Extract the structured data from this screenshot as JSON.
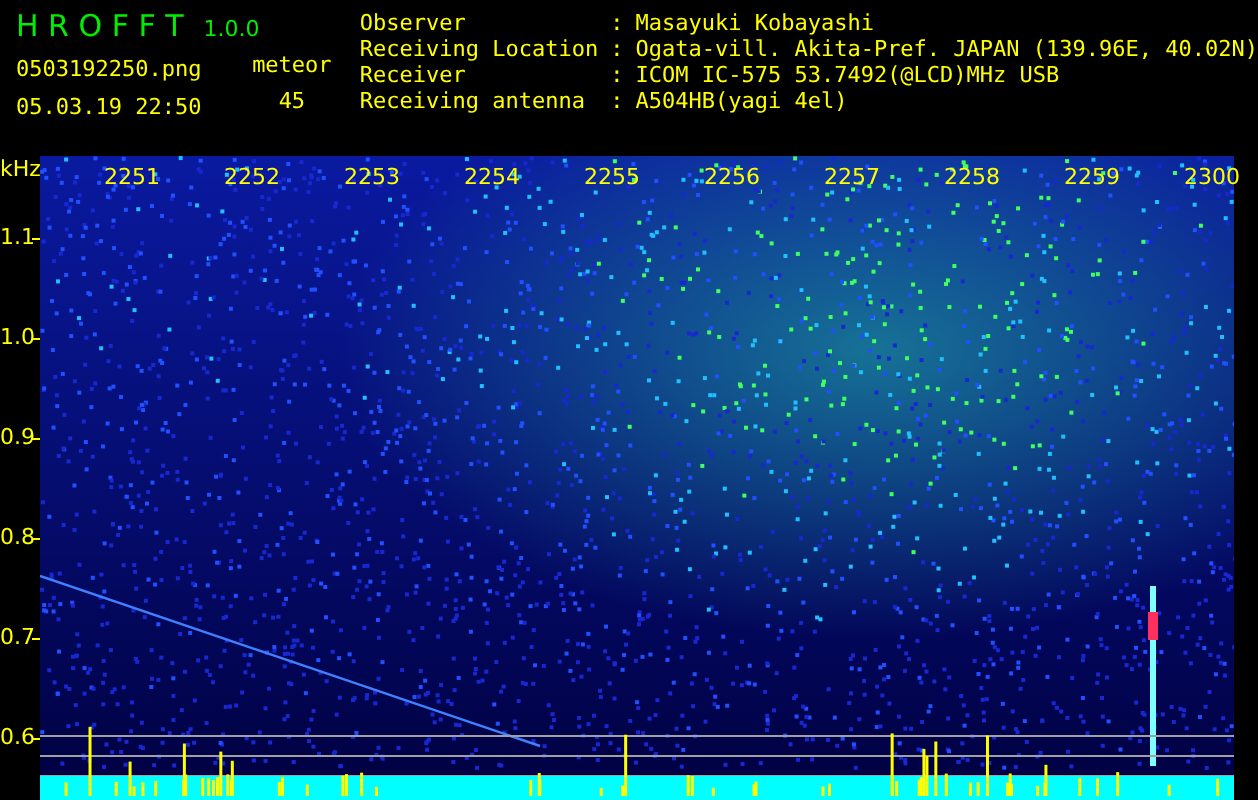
{
  "app": {
    "name": "H R O F F T",
    "version": "1.0.0"
  },
  "file_name": "0503192250.png",
  "date_time": "05.03.19 22:50",
  "meteor": {
    "label": "meteor",
    "count": "45"
  },
  "info": [
    {
      "label": "Observer",
      "separator": ":",
      "value": "Masayuki Kobayashi"
    },
    {
      "label": "Receiving Location",
      "separator": ":",
      "value": "Ogata-vill. Akita-Pref. JAPAN (139.96E, 40.02N)"
    },
    {
      "label": "Receiver",
      "separator": ":",
      "value": "ICOM IC-575 53.7492(@LCD)MHz USB"
    },
    {
      "label": "Receiving antenna",
      "separator": ":",
      "value": "A504HB(yagi 4el)"
    }
  ],
  "spectrogram": {
    "unit": "kHz",
    "time_labels": [
      "2251",
      "2252",
      "2253",
      "2254",
      "2255",
      "2256",
      "2257",
      "2258",
      "2259",
      "2300"
    ],
    "frequency_labels": [
      "1.1",
      "1.0",
      "0.9",
      "0.8",
      "0.7",
      "0.6"
    ]
  }
}
